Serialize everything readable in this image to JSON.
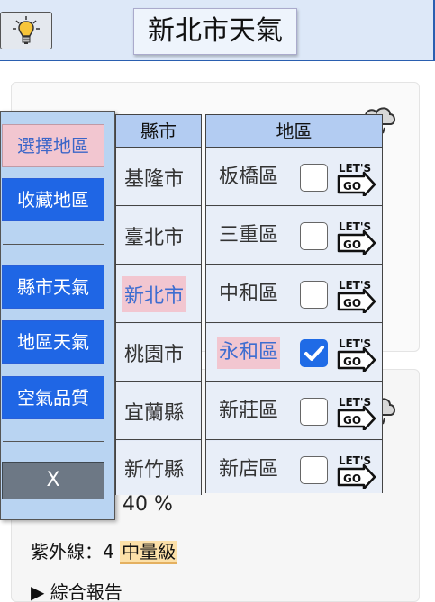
{
  "header": {
    "title": "新北市天氣",
    "bulb_icon": "lightbulb-icon"
  },
  "menu": {
    "items": [
      {
        "label": "選擇地區",
        "selected": true
      },
      {
        "label": "收藏地區",
        "selected": false
      },
      {
        "label": "縣市天氣",
        "selected": false
      },
      {
        "label": "地區天氣",
        "selected": false
      },
      {
        "label": "空氣品質",
        "selected": false
      }
    ],
    "close_label": "X"
  },
  "cities": {
    "header": "縣市",
    "items": [
      "基隆市",
      "臺北市",
      "新北市",
      "桃園市",
      "宜蘭縣",
      "新竹縣"
    ],
    "selected": "新北市"
  },
  "districts": {
    "header": "地區",
    "go_icon_text": [
      "LET'S",
      "GO"
    ],
    "items": [
      {
        "name": "板橋區",
        "checked": false,
        "selected": false
      },
      {
        "name": "三重區",
        "checked": false,
        "selected": false
      },
      {
        "name": "中和區",
        "checked": false,
        "selected": false
      },
      {
        "name": "永和區",
        "checked": true,
        "selected": true
      },
      {
        "name": "新莊區",
        "checked": false,
        "selected": false
      },
      {
        "name": "新店區",
        "checked": false,
        "selected": false
      }
    ]
  },
  "weather": {
    "humidity": "40 %",
    "uv_label": "紫外線：4",
    "uv_level": "中量級",
    "report_label": "▶ 綜合報告"
  },
  "colors": {
    "accent_blue": "#1f66e5",
    "selected_pink": "#f2c6d0",
    "header_bg": "#dde8f8"
  }
}
